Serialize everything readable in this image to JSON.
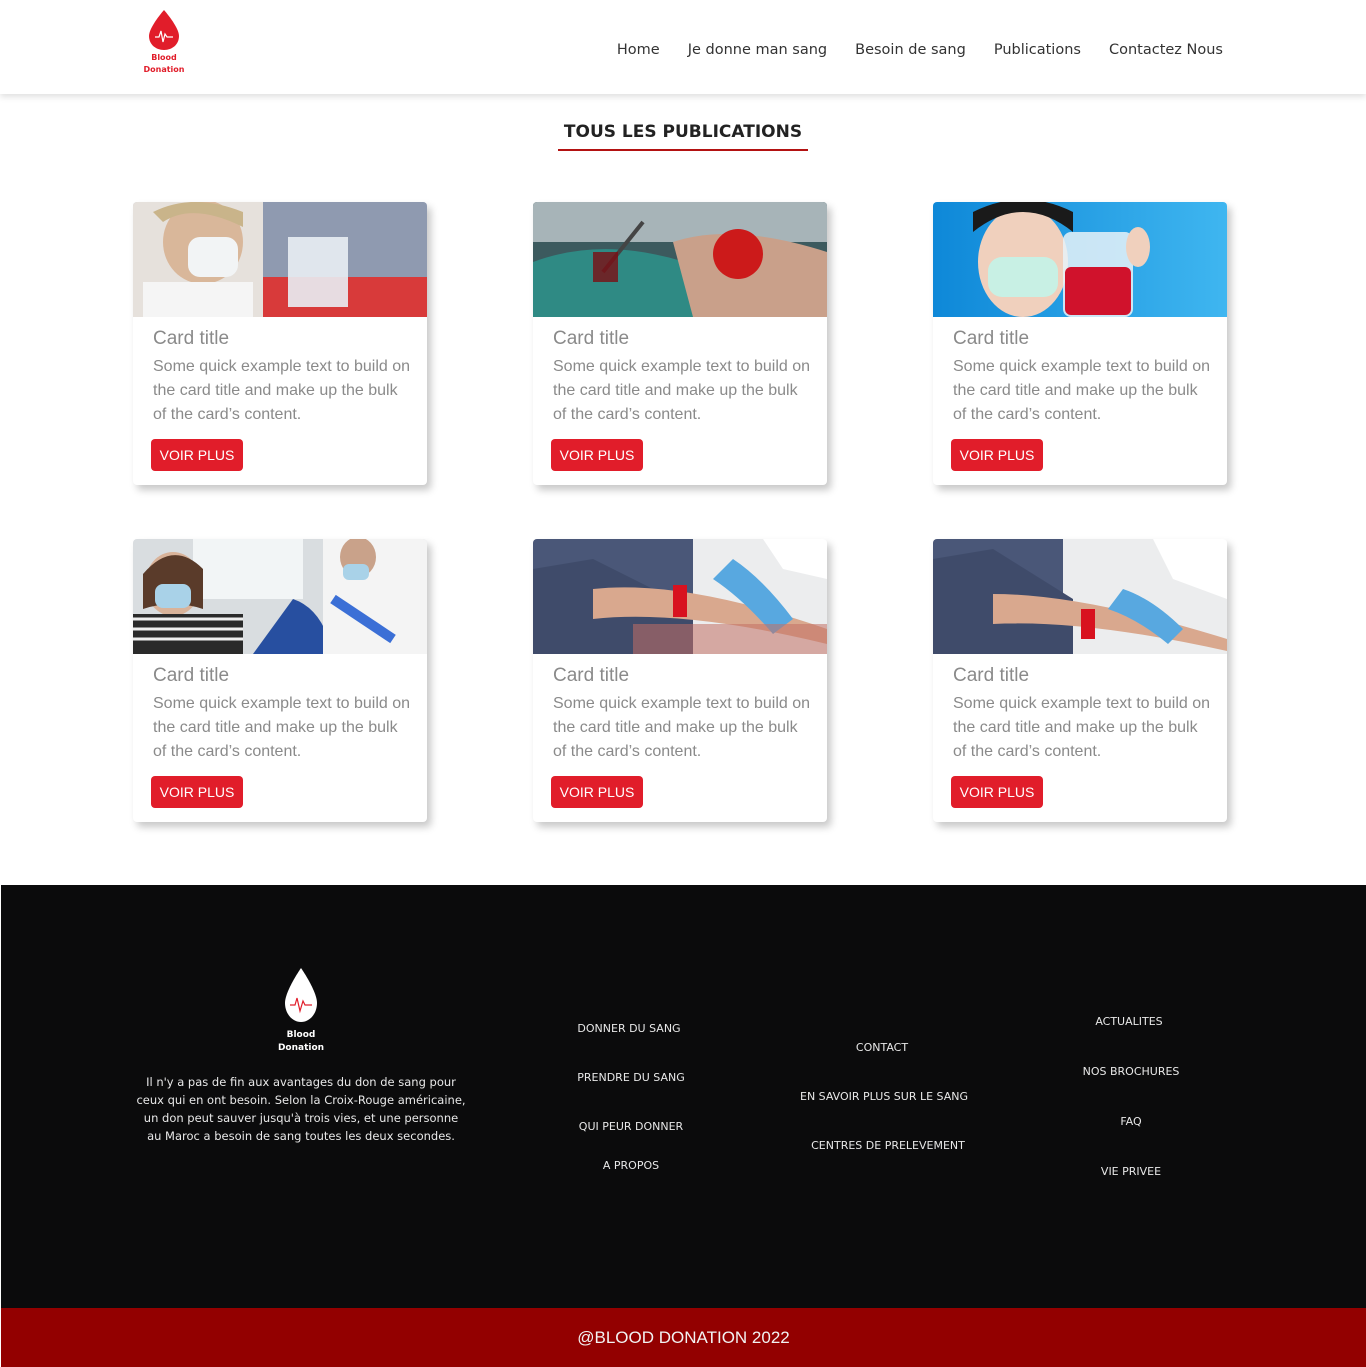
{
  "header": {
    "logo_text_line1": "Blood",
    "logo_text_line2": "Donation",
    "nav": [
      "Home",
      "Je donne man sang",
      "Besoin de sang",
      "Publications",
      "Contactez Nous"
    ]
  },
  "section": {
    "title": "TOUS LES PUBLICATIONS",
    "accent_color": "#b31212"
  },
  "cards": [
    {
      "title": "Card title",
      "text": "Some quick example text to build on the card title and make up the bulk of the card’s content.",
      "button": "VOIR PLUS",
      "image": "nurse-with-blood-bags-photo"
    },
    {
      "title": "Card title",
      "text": "Some quick example text to build on the card title and make up the bulk of the card’s content.",
      "button": "VOIR PLUS",
      "image": "hand-squeezing-heart-photo"
    },
    {
      "title": "Card title",
      "text": "Some quick example text to build on the card title and make up the bulk of the card’s content.",
      "button": "VOIR PLUS",
      "image": "masked-woman-blood-bag-photo"
    },
    {
      "title": "Card title",
      "text": "Some quick example text to build on the card title and make up the bulk of the card’s content.",
      "button": "VOIR PLUS",
      "image": "donor-in-chair-with-nurse-photo"
    },
    {
      "title": "Card title",
      "text": "Some quick example text to build on the card title and make up the bulk of the card’s content.",
      "button": "VOIR PLUS",
      "image": "arm-with-tourniquet-photo"
    },
    {
      "title": "Card title",
      "text": "Some quick example text to build on the card title and make up the bulk of the card’s content.",
      "button": "VOIR PLUS",
      "image": "arm-with-tourniquet-photo"
    }
  ],
  "footer": {
    "logo_text_line1": "Blood",
    "logo_text_line2": "Donation",
    "about": "Il n'y a pas de fin aux avantages du don de sang pour ceux qui en ont besoin. Selon la Croix-Rouge américaine, un don peut sauver jusqu'à trois vies, et une personne au Maroc a besoin de sang toutes les deux secondes.",
    "col1": [
      "DONNER DU SANG",
      "PRENDRE DU SANG",
      "QUI PEUR DONNER",
      "A PROPOS"
    ],
    "col2": [
      "CONTACT",
      "EN SAVOIR PLUS SUR LE SANG",
      "CENTRES DE PRELEVEMENT"
    ],
    "col3": [
      "ACTUALITES",
      "NOS BROCHURES",
      "FAQ",
      "VIE PRIVEE"
    ]
  },
  "copyright": "@BLOOD DONATION 2022",
  "colors": {
    "brand_red": "#e11d2a",
    "footer_bg": "#0b0b0c",
    "copyright_bg": "#930000"
  }
}
